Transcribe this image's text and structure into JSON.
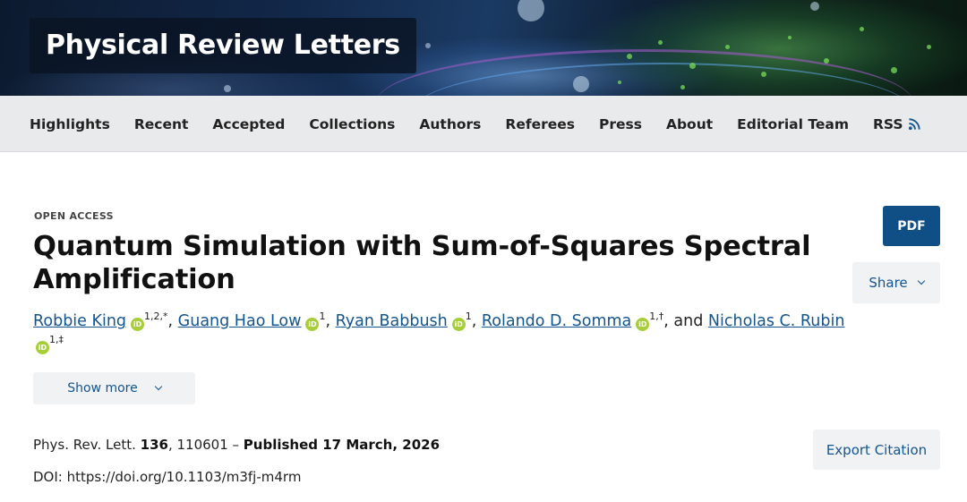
{
  "journal": {
    "title": "Physical Review Letters"
  },
  "nav": {
    "items": [
      "Highlights",
      "Recent",
      "Accepted",
      "Collections",
      "Authors",
      "Referees",
      "Press",
      "About",
      "Editorial Team",
      "RSS"
    ]
  },
  "article": {
    "access_label": "OPEN ACCESS",
    "title": "Quantum Simulation with Sum-of-Squares Spectral Amplification",
    "authors": [
      {
        "name": "Robbie King",
        "affil": "1,2,*",
        "sep": ", "
      },
      {
        "name": "Guang Hao Low",
        "affil": "1",
        "sep": ", "
      },
      {
        "name": "Ryan Babbush",
        "affil": "1",
        "sep": ", "
      },
      {
        "name": "Rolando D. Somma",
        "affil": "1,†",
        "sep": ", and "
      },
      {
        "name": "Nicholas C. Rubin",
        "affil": "1,‡",
        "sep": ""
      }
    ],
    "show_more_label": "Show more",
    "citation": {
      "journal_abbrev": "Phys. Rev. Lett.",
      "volume": "136",
      "article_number": ", 110601 – ",
      "published": "Published 17 March, 2026"
    },
    "doi": "DOI: https://doi.org/10.1103/m3fj-m4rm"
  },
  "actions": {
    "pdf_label": "PDF",
    "share_label": "Share",
    "export_label": "Export Citation"
  },
  "icons": {
    "orcid": "orcid-icon",
    "rss": "rss-icon",
    "chevron": "chevron-down-icon"
  },
  "colors": {
    "link": "#14548f",
    "pdf_button": "#0f4f86",
    "orcid": "#a6ce39",
    "nav_bg": "#e9eaec"
  }
}
